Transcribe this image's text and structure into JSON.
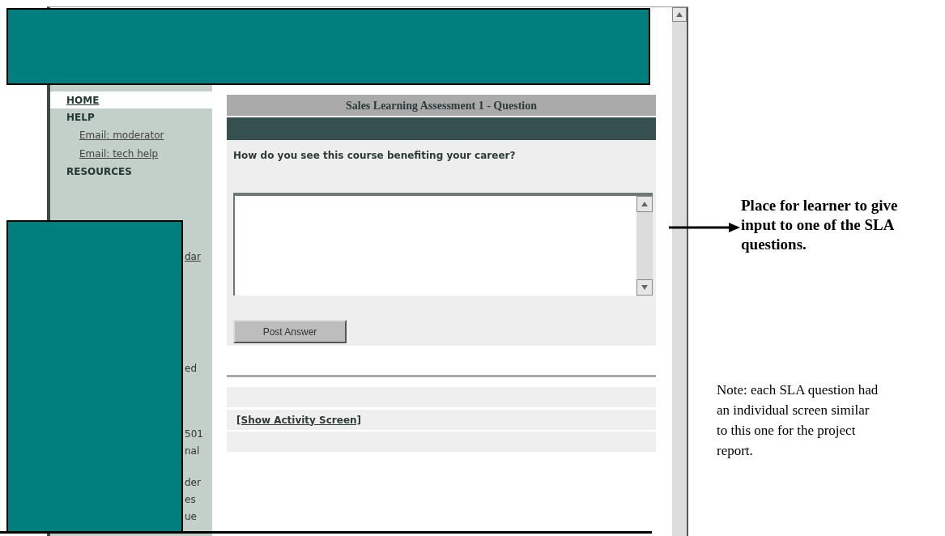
{
  "sidebar": {
    "items": [
      {
        "label": "HOME",
        "kind": "heading",
        "selected": true
      },
      {
        "label": "HELP",
        "kind": "heading",
        "selected": false
      },
      {
        "label": "Email: moderator",
        "kind": "link",
        "selected": false
      },
      {
        "label": "Email: tech help",
        "kind": "link",
        "selected": false
      },
      {
        "label": "RESOURCES",
        "kind": "heading",
        "selected": false
      }
    ],
    "fragments": [
      {
        "text": "dar",
        "kind": "link"
      },
      {
        "text": "ed",
        "kind": "text"
      },
      {
        "text": "501",
        "kind": "text"
      },
      {
        "text": "nal",
        "kind": "text"
      },
      {
        "text": "der",
        "kind": "text"
      },
      {
        "text": "es",
        "kind": "text"
      },
      {
        "text": "ue",
        "kind": "text"
      }
    ]
  },
  "main": {
    "title": "Sales Learning Assessment 1 - Question",
    "question": "How do you see this course benefiting your career?",
    "button": "Post Answer",
    "link": "[Show Activity Screen]"
  },
  "annotations": {
    "callout": "Place for learner to give input to one of the SLA questions.",
    "note": "Note: each SLA question had an individual screen similar to this one for the project report."
  }
}
